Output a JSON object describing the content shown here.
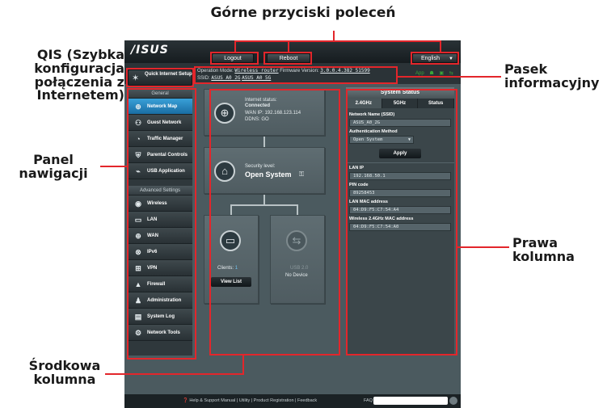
{
  "annotations": {
    "top_buttons": "Górne przyciski poleceń",
    "qis": "QIS (Szybka konfiguracja połączenia z Internetem)",
    "nav_panel": "Panel nawigacji",
    "info_bar": "Pasek informacyjny",
    "middle_column": "Środkowa kolumna",
    "right_column": "Prawa kolumna"
  },
  "topbar": {
    "logo": "/ISUS",
    "logout": "Logout",
    "reboot": "Reboot",
    "language": "English"
  },
  "qis": {
    "label": "Quick Internet Setup"
  },
  "info": {
    "op_mode_label": "Operation Mode:",
    "op_mode_value": "Wireless router",
    "firmware_label": "Firmware Version:",
    "firmware_value": "3.0.0.4.382_51599",
    "ssid_label": "SSID:",
    "ssid_1": "ASUS_A0_2G",
    "ssid_2": "ASUS_A0_5G",
    "app_label": "App"
  },
  "nav": {
    "general_header": "General",
    "general_items": [
      {
        "label": "Network Map",
        "icon": "network-map-icon"
      },
      {
        "label": "Guest Network",
        "icon": "guest-network-icon"
      },
      {
        "label": "Traffic Manager",
        "icon": "traffic-manager-icon"
      },
      {
        "label": "Parental Controls",
        "icon": "parental-controls-icon"
      },
      {
        "label": "USB Application",
        "icon": "usb-application-icon"
      }
    ],
    "advanced_header": "Advanced Settings",
    "advanced_items": [
      {
        "label": "Wireless",
        "icon": "wireless-icon"
      },
      {
        "label": "LAN",
        "icon": "lan-icon"
      },
      {
        "label": "WAN",
        "icon": "wan-icon"
      },
      {
        "label": "IPv6",
        "icon": "ipv6-icon"
      },
      {
        "label": "VPN",
        "icon": "vpn-icon"
      },
      {
        "label": "Firewall",
        "icon": "firewall-icon"
      },
      {
        "label": "Administration",
        "icon": "administration-icon"
      },
      {
        "label": "System Log",
        "icon": "system-log-icon"
      },
      {
        "label": "Network Tools",
        "icon": "network-tools-icon"
      }
    ]
  },
  "middle": {
    "internet_status_label": "Internet status:",
    "internet_status_value": "Connected",
    "wan_ip": "WAN IP: 192.168.123.114",
    "ddns": "DDNS: GO",
    "security_label": "Security level:",
    "security_value": "Open System",
    "clients_label": "Clients:",
    "clients_count": "1",
    "view_list": "View List",
    "usb_label": "USB 2.0",
    "usb_status": "No Device"
  },
  "system_status": {
    "title": "System Status",
    "tabs": [
      "2.4GHz",
      "5GHz",
      "Status"
    ],
    "network_name_label": "Network Name (SSID)",
    "network_name_value": "ASUS_A0_2G",
    "auth_method_label": "Authentication Method",
    "auth_method_value": "Open System",
    "apply": "Apply",
    "lan_ip_label": "LAN IP",
    "lan_ip_value": "192.168.50.1",
    "pin_label": "PIN code",
    "pin_value": "89258453",
    "lan_mac_label": "LAN MAC address",
    "lan_mac_value": "04:D9:F5:C7:54:A4",
    "wl_mac_label": "Wireless 2.4GHz MAC address",
    "wl_mac_value": "04:D9:F5:C7:54:A0"
  },
  "footer": {
    "help": "Help & Support",
    "links": "Manual | Utility | Product Registration | Feedback",
    "faq": "FAQ"
  },
  "colors": {
    "annotation_red": "#e3262b",
    "active_nav": "#1a6da3",
    "status_green": "#3aa538"
  }
}
